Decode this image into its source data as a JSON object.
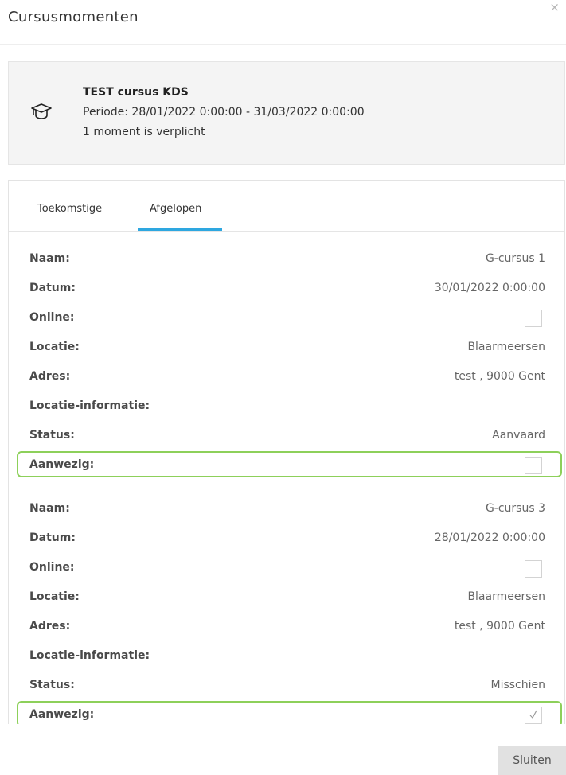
{
  "modal": {
    "title": "Cursusmomenten",
    "close_icon": "×",
    "close_button_label": "Sluiten"
  },
  "course": {
    "icon": "graduation-cap-icon",
    "title": "TEST cursus KDS",
    "period": "Periode: 28/01/2022 0:00:00 - 31/03/2022 0:00:00",
    "mandatory": "1 moment is verplicht"
  },
  "tabs": [
    {
      "label": "Toekomstige",
      "active": false
    },
    {
      "label": "Afgelopen",
      "active": true
    }
  ],
  "labels": {
    "name": "Naam:",
    "date": "Datum:",
    "online": "Online:",
    "location": "Locatie:",
    "address": "Adres:",
    "location_info": "Locatie-informatie:",
    "status": "Status:",
    "present": "Aanwezig:"
  },
  "moments": [
    {
      "name": "G-cursus 1",
      "date": "30/01/2022 0:00:00",
      "online": false,
      "location": "Blaarmeersen",
      "address": "test , 9000 Gent",
      "location_info": "",
      "status": "Aanvaard",
      "present": false
    },
    {
      "name": "G-cursus 3",
      "date": "28/01/2022 0:00:00",
      "online": false,
      "location": "Blaarmeersen",
      "address": "test , 9000 Gent",
      "location_info": "",
      "status": "Misschien",
      "present": true
    }
  ],
  "colors": {
    "highlight": "#8dd05a",
    "tab_active": "#2ea7e0"
  }
}
